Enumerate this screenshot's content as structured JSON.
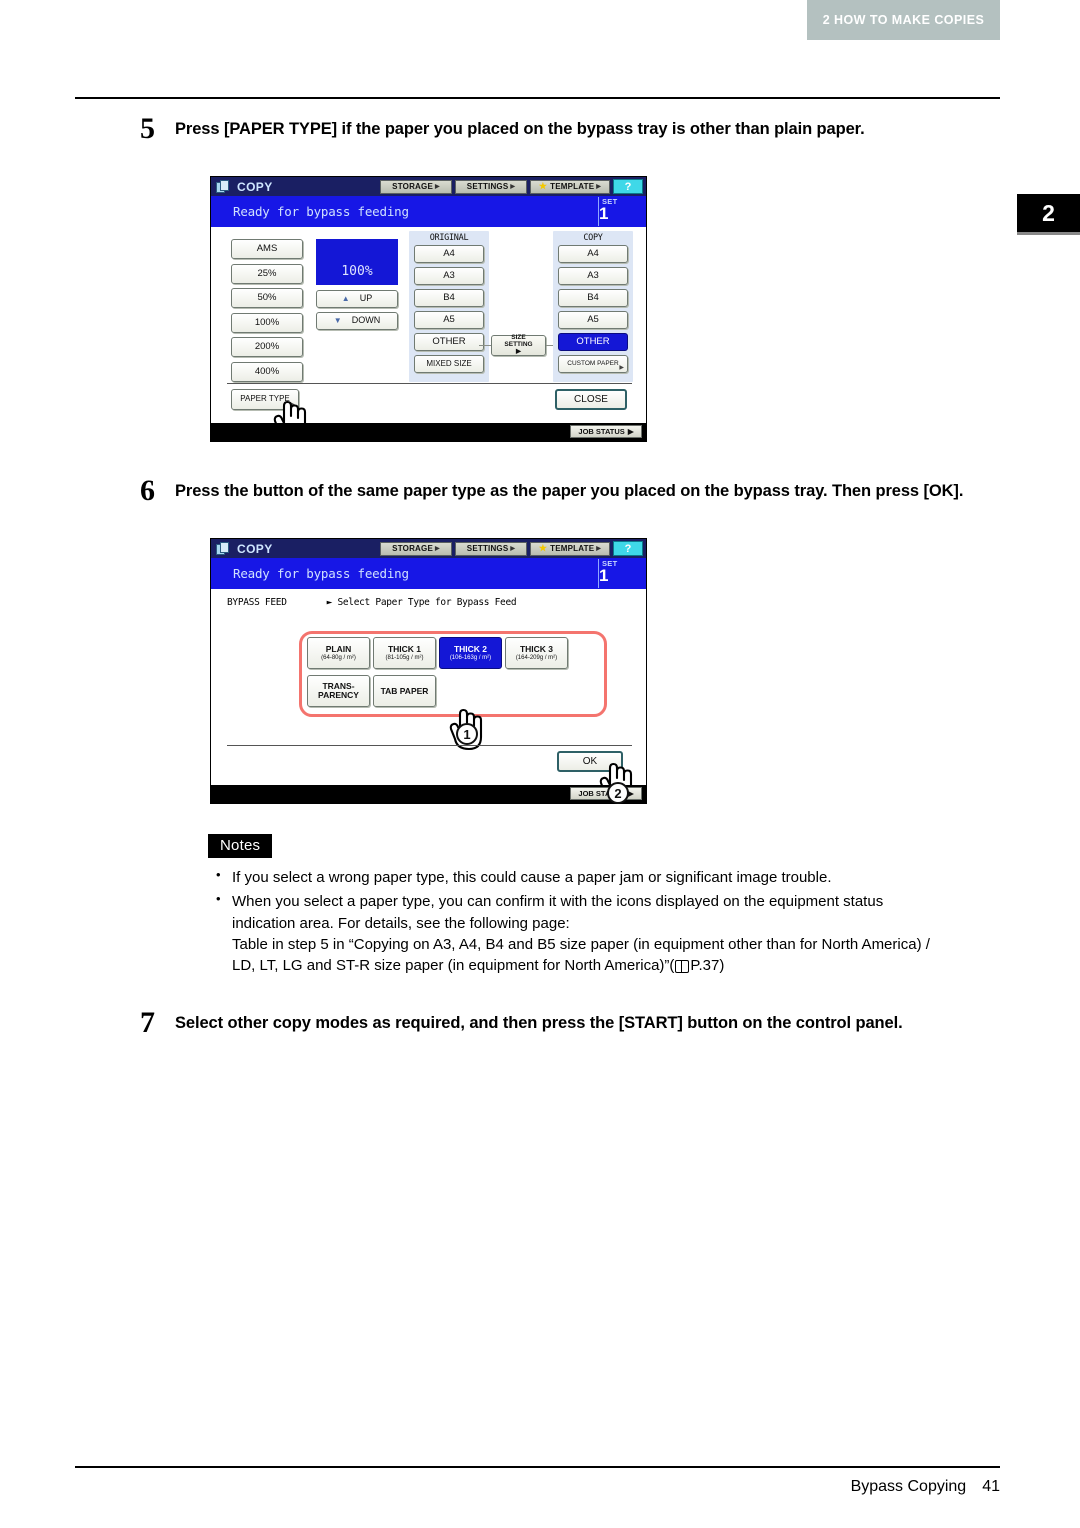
{
  "header": {
    "chapter_label": "2 HOW TO MAKE COPIES",
    "chapter_tab": "2"
  },
  "footer": {
    "section": "Bypass Copying",
    "page": "41"
  },
  "steps": [
    {
      "number": "5",
      "text": "Press [PAPER TYPE] if the paper you placed on the bypass tray is other than plain paper."
    },
    {
      "number": "6",
      "text": "Press the button of the same paper type as the paper you placed on the bypass tray. Then press [OK]."
    },
    {
      "number": "7",
      "text": "Select other copy modes as required, and then press the [START] button on the control panel."
    }
  ],
  "panel1": {
    "title": "COPY",
    "logo_icon": "copy-documents-icon",
    "toolbar": [
      {
        "label": "STORAGE",
        "icon": "arrow-right-icon"
      },
      {
        "label": "SETTINGS",
        "icon": "arrow-right-icon"
      },
      {
        "label": "TEMPLATE",
        "icon": "star-icon"
      }
    ],
    "help_label": "?",
    "status_message": "Ready for bypass feeding",
    "set_label": "SET",
    "set_value": "1",
    "zoom_keys": [
      "AMS",
      "25%",
      "50%",
      "100%",
      "200%",
      "400%"
    ],
    "ratio_value": "100%",
    "up_label": "UP",
    "down_label": "DOWN",
    "up_icon": "triangle-up-icon",
    "down_icon": "triangle-down-icon",
    "original": {
      "header": "ORIGINAL",
      "keys": [
        "A4",
        "A3",
        "B4",
        "A5",
        "OTHER",
        "MIXED SIZE"
      ],
      "selected": ""
    },
    "copy": {
      "header": "COPY",
      "keys": [
        "A4",
        "A3",
        "B4",
        "A5",
        "OTHER",
        "CUSTOM PAPER"
      ],
      "selected": "OTHER"
    },
    "size_setting": {
      "line1": "SIZE",
      "line2": "SETTING"
    },
    "paper_type_label": "PAPER TYPE",
    "close_label": "CLOSE",
    "job_status_label": "JOB STATUS",
    "cursor_icon": "hand-pointer-icon"
  },
  "panel2": {
    "title": "COPY",
    "logo_icon": "copy-documents-icon",
    "toolbar": [
      {
        "label": "STORAGE",
        "icon": "arrow-right-icon"
      },
      {
        "label": "SETTINGS",
        "icon": "arrow-right-icon"
      },
      {
        "label": "TEMPLATE",
        "icon": "star-icon"
      }
    ],
    "help_label": "?",
    "status_message": "Ready for bypass feeding",
    "set_label": "SET",
    "set_value": "1",
    "breadcrumb_root": "BYPASS FEED",
    "breadcrumb_current": "► Select Paper Type for Bypass Feed",
    "paper_types": [
      {
        "name": "PLAIN",
        "weight": "(64-80g / m²)",
        "selected": false
      },
      {
        "name": "THICK 1",
        "weight": "(81-105g / m²)",
        "selected": false
      },
      {
        "name": "THICK 2",
        "weight": "(106-163g / m²)",
        "selected": true
      },
      {
        "name": "THICK 3",
        "weight": "(164-209g / m²)",
        "selected": false
      },
      {
        "name": "TRANS-\nPARENCY",
        "weight": "",
        "selected": false
      },
      {
        "name": "TAB PAPER",
        "weight": "",
        "selected": false
      }
    ],
    "ok_label": "OK",
    "job_status_label": "JOB STATUS",
    "callout_1": "1",
    "callout_2": "2",
    "highlight_color": "#f4746e",
    "selected_color": "#1417d6",
    "cursor_icon": "hand-pointer-icon"
  },
  "notes": {
    "badge": "Notes",
    "items": [
      {
        "lines": [
          "If you select a wrong paper type, this could cause a paper jam or significant image trouble."
        ]
      },
      {
        "lines": [
          "When you select a paper type, you can confirm it with the icons displayed on the equipment status",
          "indication area. For details, see the following page:",
          "Table in step 5 in “Copying on A3, A4, B4 and B5 size paper (in equipment other than for North America) /",
          "LD, LT, LG and ST-R size paper (in equipment for North America)”(",
          "P.37)"
        ]
      }
    ]
  }
}
